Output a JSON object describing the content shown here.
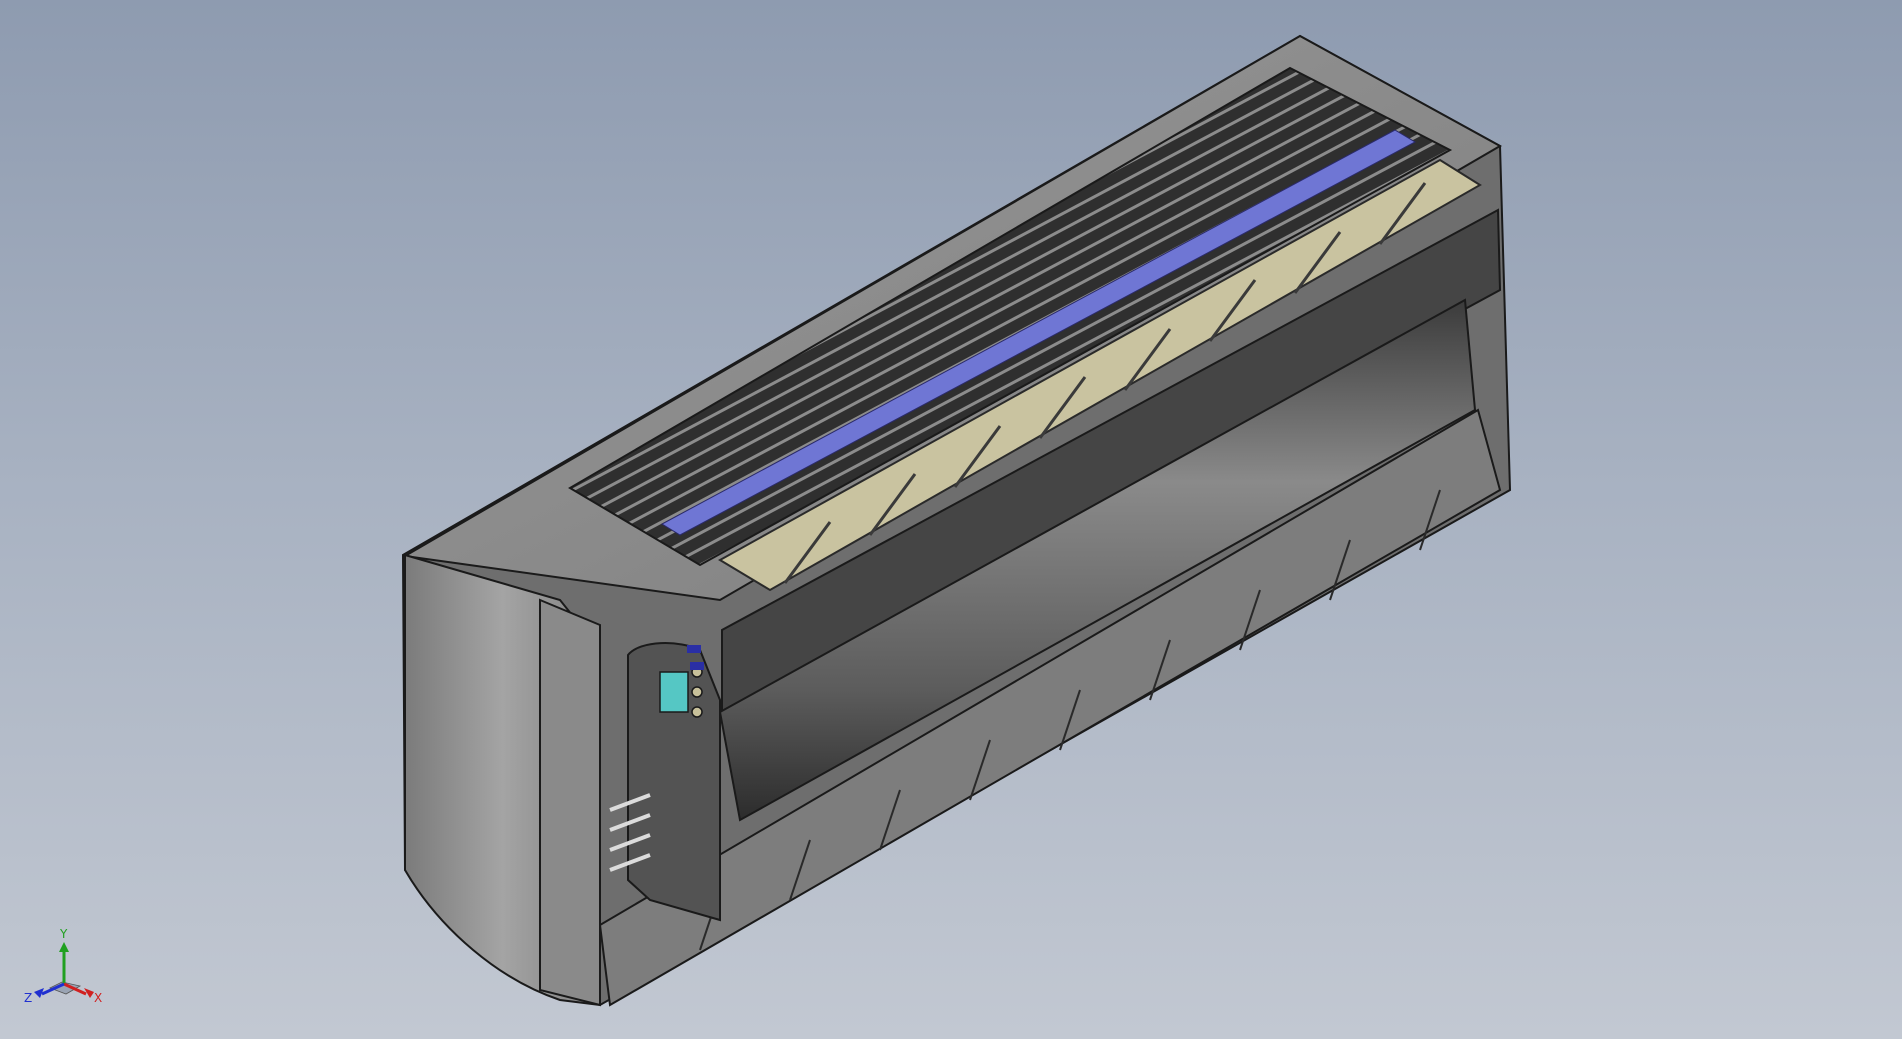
{
  "viewport": {
    "background_top": "#8e9bb0",
    "background_bottom": "#c2c8d2"
  },
  "model": {
    "subject": "split-air-conditioner-indoor-unit",
    "colors": {
      "housing": "#8d8d8d",
      "housing_dark": "#5a5a5a",
      "grille": "#2e2e2e",
      "blower": "#6f6f6f",
      "filter": "#c9c3a0",
      "coil_band": "#6f76d4",
      "pipe": "#55c7c4",
      "outline": "#1a1a1a"
    }
  },
  "triad": {
    "y_label": "Y",
    "x_label": "X",
    "z_label": "Z",
    "colors": {
      "x": "#d02020",
      "y": "#20a020",
      "z": "#2030d0"
    }
  }
}
